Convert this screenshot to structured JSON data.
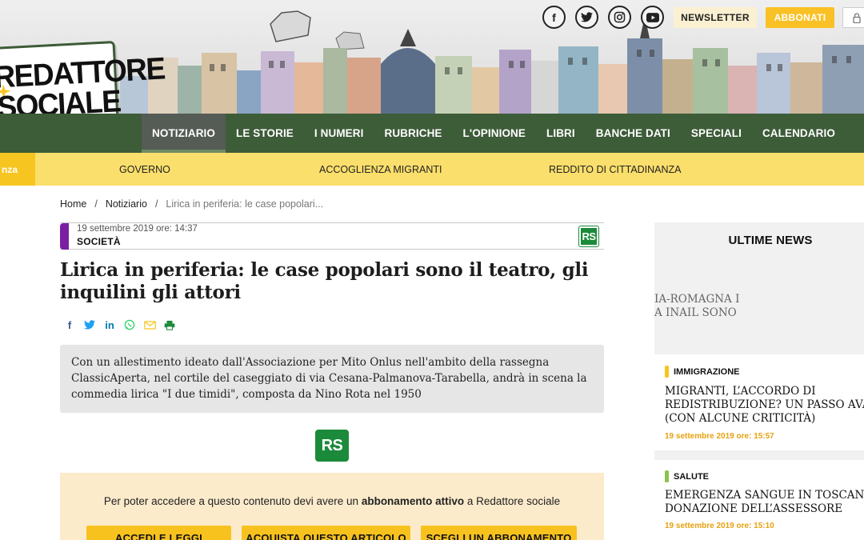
{
  "header": {
    "logo_line1": "REDATTORE",
    "logo_line2": "SOCIALE",
    "social_icons": [
      "facebook-icon",
      "twitter-icon",
      "instagram-icon",
      "youtube-icon"
    ],
    "newsletter_label": "NEWSLETTER",
    "abbonati_label": "ABBONATI",
    "colors": {
      "accent_yellow": "#f9c126",
      "nav_green": "#3d5c38"
    }
  },
  "mainnav": {
    "items": [
      {
        "label": "NOTIZIARIO",
        "active": true
      },
      {
        "label": "LE STORIE"
      },
      {
        "label": "I NUMERI"
      },
      {
        "label": "RUBRICHE"
      },
      {
        "label": "L'OPINIONE"
      },
      {
        "label": "LIBRI"
      },
      {
        "label": "BANCHE DATI"
      },
      {
        "label": "SPECIALI"
      },
      {
        "label": "CALENDARIO"
      }
    ]
  },
  "subnav": {
    "tag": "nza",
    "links": [
      "GOVERNO",
      "ACCOGLIENZA MIGRANTI",
      "REDDITO DI CITTADINANZA"
    ]
  },
  "breadcrumb": {
    "home": "Home",
    "section": "Notiziario",
    "current": "Lirica in periferia: le case popolari..."
  },
  "article": {
    "date": "19 settembre 2019 ore: 14:37",
    "category": "SOCIETÀ",
    "badge": "RS",
    "title": "Lirica in periferia: le case popolari sono il teatro, gli inquilini gli attori",
    "share_icons": [
      "facebook-icon",
      "twitter-icon",
      "linkedin-icon",
      "whatsapp-icon",
      "email-icon",
      "print-icon"
    ],
    "summary": "Con un allestimento ideato dall'Associazione per Mito Onlus nell'ambito della rassegna ClassicAperta, nel cortile del caseggiato di via Cesana-Palmanova-Tarabella, andrà in scena la commedia lirica \"I due timidi\", composta da Nino Rota nel 1950",
    "paywall": {
      "text_before": "Per poter accedere a questo contenuto devi avere un ",
      "text_bold": "abbonamento attivo",
      "text_after": " a Redattore sociale",
      "buttons": [
        "ACCEDI E LEGGI",
        "ACQUISTA QUESTO ARTICOLO",
        "SCEGLI UN ABBONAMENTO"
      ]
    }
  },
  "sidebar": {
    "title": "ULTIME NEWS",
    "fragment_line1": "IA-ROMAGNA I",
    "fragment_line2": "A INAIL SONO",
    "items": [
      {
        "category": "IMMIGRAZIONE",
        "category_color": "#f6c51f",
        "headline_lines": [
          "MIGRANTI, L’ACCORDO DI",
          "REDISTRIBUZIONE? UN PASSO AVANTI",
          "(CON ALCUNE CRITICITÀ)"
        ],
        "date": "19 settembre 2019 ore: 15:57"
      },
      {
        "category": "SALUTE",
        "category_color": "#8bc34a",
        "headline_lines": [
          "EMERGENZA SANGUE IN TOSCANA, LA",
          "DONAZIONE DELL’ASSESSORE"
        ],
        "date": "19 settembre 2019 ore: 15:10"
      }
    ]
  }
}
